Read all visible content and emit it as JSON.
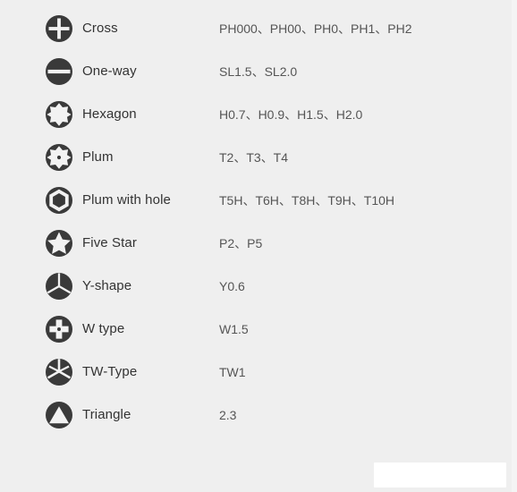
{
  "page": {
    "background_color": "#efefef",
    "icon_color": "#3a3a3a",
    "label_color": "#333333",
    "spec_color": "#555555"
  },
  "rows": [
    {
      "icon": "cross-head-icon",
      "label": "Cross",
      "specs": "PH000、PH00、PH0、PH1、PH2"
    },
    {
      "icon": "one-way-slotted-head-icon",
      "label": "One-way",
      "specs": "SL1.5、SL2.0"
    },
    {
      "icon": "hexagon-star-head-icon",
      "label": "Hexagon",
      "specs": "H0.7、H0.9、H1.5、H2.0"
    },
    {
      "icon": "plum-torx-head-icon",
      "label": "Plum",
      "specs": "T2、T3、T4"
    },
    {
      "icon": "plum-with-hole-head-icon",
      "label": "Plum with hole",
      "specs": "T5H、T6H、T8H、T9H、T10H"
    },
    {
      "icon": "five-star-head-icon",
      "label": "Five Star",
      "specs": "P2、P5"
    },
    {
      "icon": "y-shape-head-icon",
      "label": "Y-shape",
      "specs": "Y0.6"
    },
    {
      "icon": "w-type-head-icon",
      "label": "W type",
      "specs": "W1.5"
    },
    {
      "icon": "tw-type-head-icon",
      "label": "TW-Type",
      "specs": "TW1"
    },
    {
      "icon": "triangle-head-icon",
      "label": "Triangle",
      "specs": "2.3"
    }
  ],
  "bottom_box": {
    "text": ""
  }
}
